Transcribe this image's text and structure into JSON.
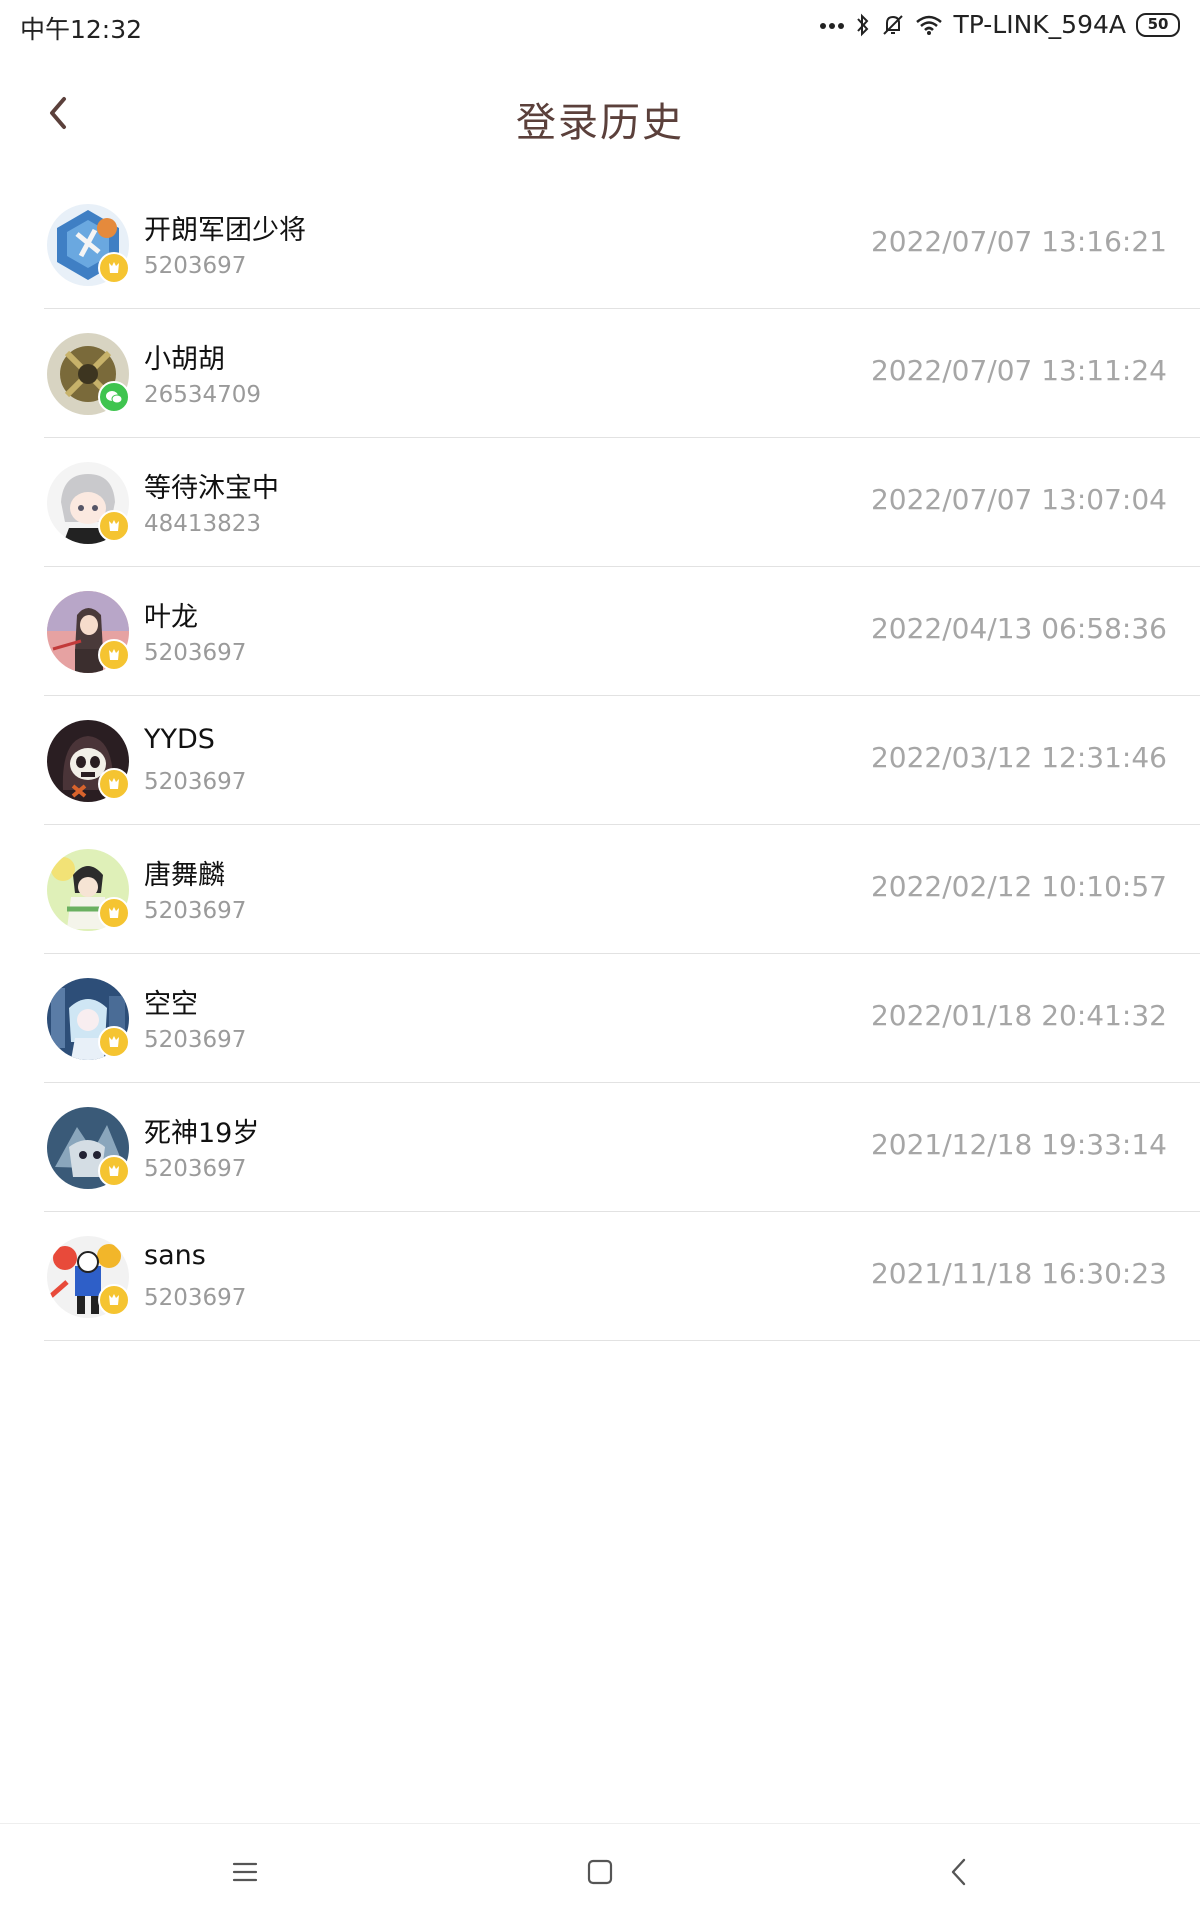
{
  "status_bar": {
    "time": "中午12:32",
    "wifi_name": "TP-LINK_594A",
    "battery": "50",
    "icons": [
      "more-dots-icon",
      "bluetooth-icon",
      "mute-bell-icon",
      "wifi-icon",
      "battery-icon"
    ]
  },
  "header": {
    "title": "登录历史",
    "back_icon": "chevron-left-icon",
    "title_color": "#5b403b"
  },
  "login_history": [
    {
      "name": "开朗军团少将",
      "uid": "5203697",
      "time": "2022/07/07 13:16:21",
      "badge": "gold-badge-icon"
    },
    {
      "name": "小胡胡",
      "uid": "26534709",
      "time": "2022/07/07 13:11:24",
      "badge": "wechat-badge-icon"
    },
    {
      "name": "等待沐宝中",
      "uid": "48413823",
      "time": "2022/07/07 13:07:04",
      "badge": "gold-badge-icon"
    },
    {
      "name": "叶龙",
      "uid": "5203697",
      "time": "2022/04/13 06:58:36",
      "badge": "gold-badge-icon"
    },
    {
      "name": "YYDS",
      "uid": "5203697",
      "time": "2022/03/12 12:31:46",
      "badge": "gold-badge-icon"
    },
    {
      "name": "唐舞麟",
      "uid": "5203697",
      "time": "2022/02/12 10:10:57",
      "badge": "gold-badge-icon"
    },
    {
      "name": "空空",
      "uid": "5203697",
      "time": "2022/01/18 20:41:32",
      "badge": "gold-badge-icon"
    },
    {
      "name": "死神19岁",
      "uid": "5203697",
      "time": "2021/12/18 19:33:14",
      "badge": "gold-badge-icon"
    },
    {
      "name": "sans",
      "uid": "5203697",
      "time": "2021/11/18 16:30:23",
      "badge": "gold-badge-icon"
    }
  ],
  "nav_bar": {
    "icons": [
      "menu-icon",
      "home-square-icon",
      "back-chevron-icon"
    ]
  },
  "colors": {
    "gold_badge": "#f5c431",
    "wechat_badge": "#3fc44f",
    "secondary_text": "#9a9a9a"
  }
}
